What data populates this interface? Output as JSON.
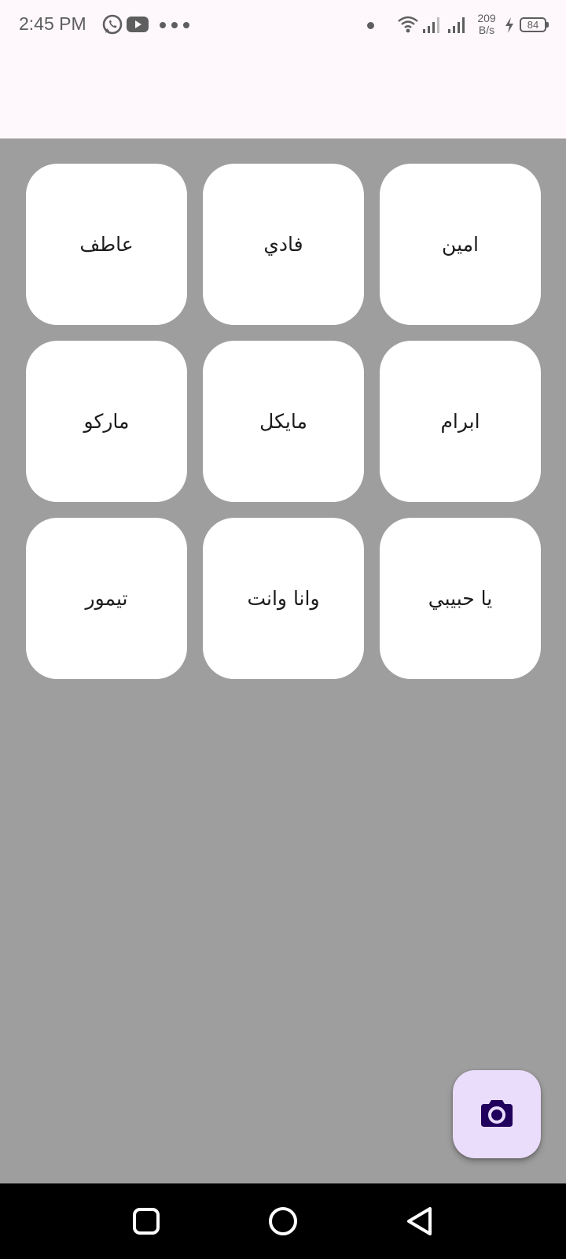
{
  "status_bar": {
    "time": "2:45 PM",
    "net_speed_value": "209",
    "net_speed_unit": "B/s",
    "battery_level": "84",
    "icons": [
      "whatsapp-icon",
      "youtube-icon",
      "more-dots-icon",
      "notification-dot-icon",
      "wifi-icon",
      "signal-icon",
      "signal-icon",
      "charging-icon",
      "battery-icon"
    ]
  },
  "grid": {
    "items": [
      {
        "label": "امين"
      },
      {
        "label": "فادي"
      },
      {
        "label": "عاطف"
      },
      {
        "label": "ابرام"
      },
      {
        "label": "مايكل"
      },
      {
        "label": "ماركو"
      },
      {
        "label": "يا حبيبي"
      },
      {
        "label": "وانا وانت"
      },
      {
        "label": "تيمور"
      }
    ]
  },
  "fab": {
    "icon": "camera-icon"
  },
  "nav_bar": {
    "icons": [
      "recents-square-icon",
      "home-circle-icon",
      "back-triangle-icon"
    ]
  },
  "colors": {
    "background_top": "#fef8fc",
    "content_background": "#9e9e9e",
    "card": "#ffffff",
    "fab_background": "#eadcfb",
    "fab_icon": "#21005d",
    "nav_bar": "#000000"
  }
}
